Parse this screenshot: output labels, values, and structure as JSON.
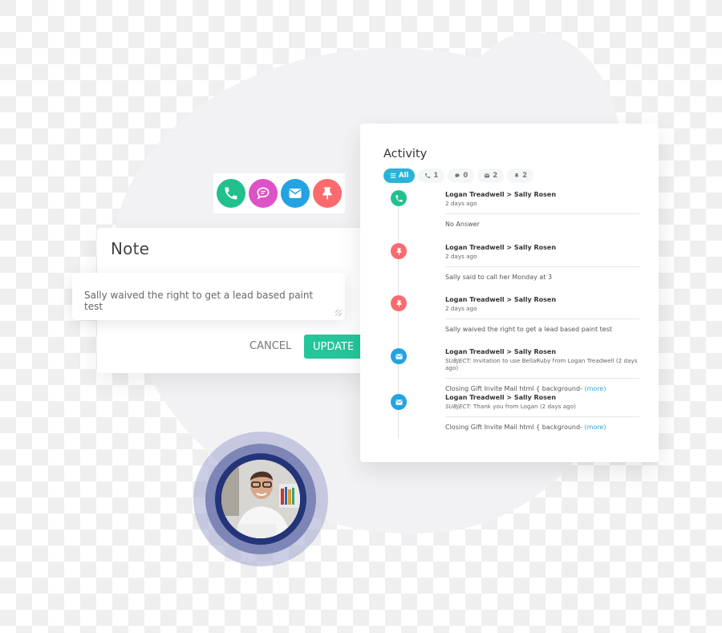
{
  "quick_actions": [
    {
      "icon": "phone-icon",
      "label": "Call",
      "color": "#23c08f"
    },
    {
      "icon": "chat-icon",
      "label": "Message",
      "color": "#dd52c6"
    },
    {
      "icon": "mail-icon",
      "label": "Email",
      "color": "#23a3e3"
    },
    {
      "icon": "pin-icon",
      "label": "Note",
      "color": "#fb6b6e"
    }
  ],
  "note": {
    "title": "Note",
    "value": "Sally waived the right to get a lead based paint test",
    "cancel_label": "CANCEL",
    "update_label": "UPDATE"
  },
  "activity": {
    "title": "Activity",
    "filters": [
      {
        "icon": "list-icon",
        "label": "All",
        "active": true
      },
      {
        "icon": "phone-icon",
        "label": "1"
      },
      {
        "icon": "chat-icon",
        "label": "0"
      },
      {
        "icon": "mail-icon",
        "label": "2"
      },
      {
        "icon": "pin-icon",
        "label": "2"
      }
    ],
    "entries": [
      {
        "type": "call",
        "icon": "phone-icon",
        "color": "#23c08f",
        "header": "Logan Treadwell > Sally Rosen",
        "time": "2 days ago",
        "body": "No Answer"
      },
      {
        "type": "note",
        "icon": "pin-icon",
        "color": "#fb6b6e",
        "header": "Logan Treadwell > Sally Rosen",
        "time": "2 days ago",
        "body": "Sally said to call her Monday at 3"
      },
      {
        "type": "note",
        "icon": "pin-icon",
        "color": "#fb6b6e",
        "header": "Logan Treadwell > Sally Rosen",
        "time": "2 days ago",
        "body": "Sally waived the right to get a lead based paint test"
      },
      {
        "type": "email",
        "icon": "mail-icon",
        "color": "#23a3e3",
        "header": "Logan Treadwell > Sally Rosen",
        "subject_label": "SUBJECT:",
        "subject": "Invitation to use BellaRuby from Logan Treadwell  (2 days ago)",
        "body": "Closing Gift Invite Mail html { background-",
        "more": "(more)"
      },
      {
        "type": "email",
        "icon": "mail-icon",
        "color": "#23a3e3",
        "header": "Logan Treadwell > Sally Rosen",
        "subject_label": "SUBJECT:",
        "subject": "Thank you from Logan  (2 days ago)",
        "body": "Closing Gift Invite Mail html { background-",
        "more": "(more)"
      }
    ]
  },
  "avatar": {
    "alt": "Smiling man with glasses"
  }
}
